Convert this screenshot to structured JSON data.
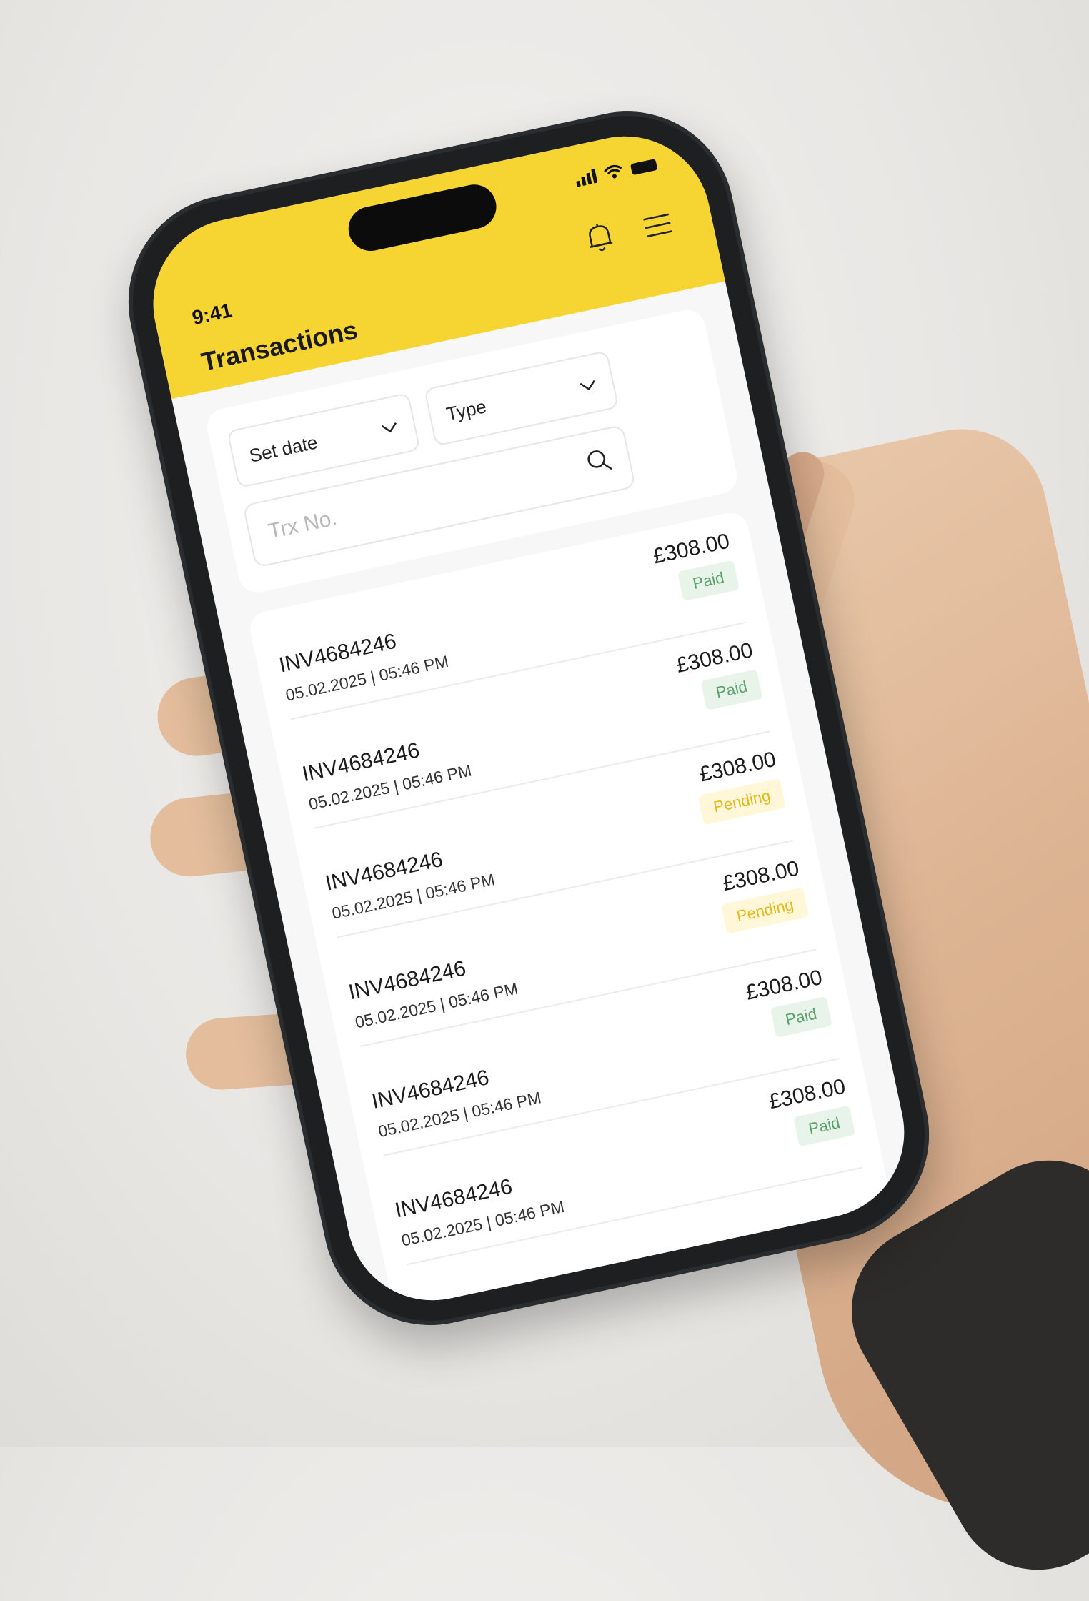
{
  "status_bar": {
    "time": "9:41"
  },
  "header": {
    "title": "Transactions",
    "accent_color": "#F6D431",
    "icons": [
      "bell-icon",
      "menu-icon"
    ]
  },
  "filters": {
    "date_select": "Set date",
    "type_select": "Type",
    "search_placeholder": "Trx No."
  },
  "transactions": [
    {
      "id": "INV4684246",
      "datetime": "05.02.2025 | 05:46 PM",
      "amount": "£308.00",
      "status": "Paid"
    },
    {
      "id": "INV4684246",
      "datetime": "05.02.2025 | 05:46 PM",
      "amount": "£308.00",
      "status": "Paid"
    },
    {
      "id": "INV4684246",
      "datetime": "05.02.2025 | 05:46 PM",
      "amount": "£308.00",
      "status": "Pending"
    },
    {
      "id": "INV4684246",
      "datetime": "05.02.2025 | 05:46 PM",
      "amount": "£308.00",
      "status": "Pending"
    },
    {
      "id": "INV4684246",
      "datetime": "05.02.2025 | 05:46 PM",
      "amount": "£308.00",
      "status": "Paid"
    },
    {
      "id": "INV4684246",
      "datetime": "05.02.2025 | 05:46 PM",
      "amount": "£308.00",
      "status": "Paid"
    }
  ],
  "colors": {
    "paid_text": "#5AA06A",
    "paid_bg": "#E8F4E9",
    "pending_text": "#E2B81A",
    "pending_bg": "#FFF7D8"
  }
}
